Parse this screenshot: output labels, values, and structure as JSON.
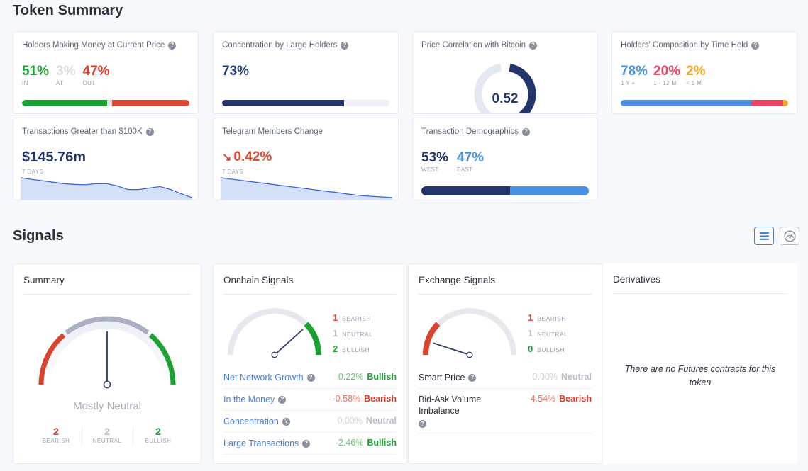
{
  "sections": {
    "token_summary_title": "Token Summary",
    "signals_title": "Signals"
  },
  "help_glyph": "?",
  "view_toggles": {
    "list": {
      "name": "list-view",
      "label": "List view"
    },
    "gauge": {
      "name": "gauge-view",
      "label": "Gauge view"
    }
  },
  "cards": {
    "holders_making_money": {
      "title": "Holders Making Money at Current Price",
      "stats": [
        {
          "value": "51%",
          "label": "IN",
          "color": "#1aa233"
        },
        {
          "value": "3%",
          "label": "AT",
          "color": "#d9dce3"
        },
        {
          "value": "47%",
          "label": "OUT",
          "color": "#d93b28"
        }
      ],
      "bar": [
        {
          "pct": 51,
          "color": "#1aa233"
        },
        {
          "pct": 3,
          "color": "#e2e5ea"
        },
        {
          "pct": 46,
          "color": "#e0492f"
        }
      ]
    },
    "concentration_large_holders": {
      "title": "Concentration by Large Holders",
      "value": "73%",
      "bar": [
        {
          "pct": 73,
          "color": "#23356b"
        },
        {
          "pct": 27,
          "color": "#eef1f7"
        }
      ]
    },
    "price_correlation_bitcoin": {
      "title": "Price Correlation with Bitcoin",
      "value": "0.52",
      "gauge": {
        "fraction": 0.52,
        "color": "#23356b",
        "track": "#e4e8f0"
      }
    },
    "holders_composition": {
      "title": "Holders' Composition by Time Held",
      "stats": [
        {
          "value": "78%",
          "label": "1 Y +",
          "color": "#4a90e2"
        },
        {
          "value": "20%",
          "label": "1 - 12 M",
          "color": "#ef4267"
        },
        {
          "value": "2%",
          "label": "< 1 M",
          "color": "#f5a623"
        }
      ],
      "bar": [
        {
          "pct": 78,
          "color": "#4a90e2"
        },
        {
          "pct": 19,
          "color": "#ef4267"
        },
        {
          "pct": 3,
          "color": "#f5a623"
        }
      ]
    },
    "transactions_over_100k": {
      "title": "Transactions Greater than $100K",
      "value": "$145.76m",
      "period": "7 DAYS",
      "sparkline": [
        62,
        58,
        54,
        50,
        46,
        44,
        43,
        46,
        46,
        40,
        30,
        30,
        34,
        38,
        30,
        18,
        8
      ]
    },
    "telegram_members_change": {
      "title": "Telegram Members Change",
      "value": "0.42%",
      "arrow": "↘",
      "period": "7 DAYS",
      "value_color": "#e0492f",
      "sparkline": [
        62,
        58,
        54,
        50,
        46,
        42,
        38,
        34,
        30,
        26,
        22,
        18,
        14,
        10,
        8,
        6,
        4
      ]
    },
    "transaction_demographics": {
      "title": "Transaction Demographics",
      "stats": [
        {
          "value": "53%",
          "label": "WEST",
          "color": "#23356b"
        },
        {
          "value": "47%",
          "label": "EAST",
          "color": "#4a90e2"
        }
      ],
      "bar": [
        {
          "pct": 53,
          "color": "#23356b"
        },
        {
          "pct": 47,
          "color": "#4a90e2"
        }
      ]
    }
  },
  "signals": {
    "summary": {
      "title": "Summary",
      "caption": "Mostly Neutral",
      "needle_angle_deg": 0,
      "stats": [
        {
          "value": "2",
          "label": "BEARISH",
          "color": "#d93b28"
        },
        {
          "value": "2",
          "label": "NEUTRAL",
          "color": "#b9bec9"
        },
        {
          "value": "2",
          "label": "BULLISH",
          "color": "#1aa233"
        }
      ]
    },
    "onchain": {
      "title": "Onchain Signals",
      "needle_angle_deg": 48,
      "legend": [
        {
          "value": "1",
          "label": "BEARISH",
          "color": "#e0492f"
        },
        {
          "value": "1",
          "label": "NEUTRAL",
          "color": "#b9bec9"
        },
        {
          "value": "2",
          "label": "BULLISH",
          "color": "#1aa233"
        }
      ],
      "arc": {
        "bearish": 0,
        "neutral": 0.5,
        "bullish": 0.5
      },
      "rows": [
        {
          "name": "Net Network Growth",
          "help": true,
          "link": true,
          "pct": "0.22%",
          "verdict": "Bullish",
          "kind": "bull"
        },
        {
          "name": "In the Money",
          "help": true,
          "link": true,
          "pct": "-0.58%",
          "verdict": "Bearish",
          "kind": "bear"
        },
        {
          "name": "Concentration",
          "help": true,
          "link": true,
          "pct": "0.00%",
          "verdict": "Neutral",
          "kind": "neut"
        },
        {
          "name": "Large Transactions",
          "help": true,
          "link": true,
          "pct": "-2.46%",
          "verdict": "Bullish",
          "kind": "bull"
        }
      ]
    },
    "exchange": {
      "title": "Exchange Signals",
      "needle_angle_deg": -72,
      "legend": [
        {
          "value": "1",
          "label": "BEARISH",
          "color": "#e0492f"
        },
        {
          "value": "1",
          "label": "NEUTRAL",
          "color": "#b9bec9"
        },
        {
          "value": "0",
          "label": "BULLISH",
          "color": "#1aa233"
        }
      ],
      "arc": {
        "bearish": 0.5,
        "neutral": 0.5,
        "bullish": 0
      },
      "rows": [
        {
          "name": "Smart Price",
          "help": true,
          "link": false,
          "pct": "0.00%",
          "verdict": "Neutral",
          "kind": "neut"
        },
        {
          "name": "Bid-Ask Volume Imbalance",
          "help": true,
          "link": false,
          "pct": "-4.54%",
          "verdict": "Bearish",
          "kind": "bear"
        }
      ]
    },
    "derivatives": {
      "title": "Derivatives",
      "empty_message": "There are no Futures contracts for this token"
    }
  }
}
